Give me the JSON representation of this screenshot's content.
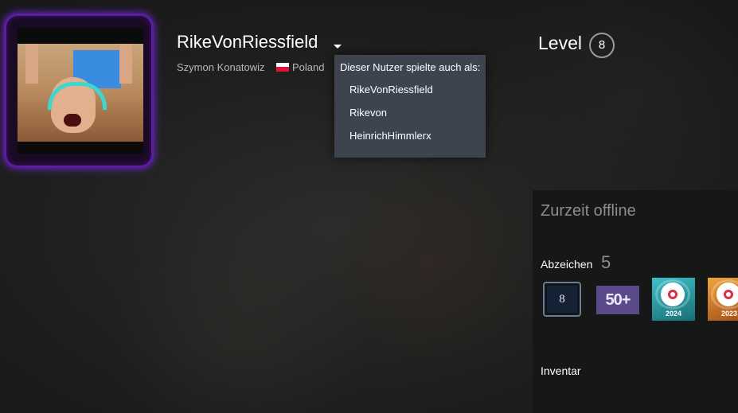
{
  "profile": {
    "persona_name": "RikeVonRiessfield",
    "real_name": "Szymon Konatowiz",
    "country": "Poland",
    "level_label": "Level",
    "level": "8"
  },
  "aliases": {
    "header": "Dieser Nutzer spielte auch als:",
    "items": [
      "RikeVonRiessfield",
      "Rikevon",
      "HeinrichHimmlerx"
    ]
  },
  "sidebar": {
    "status": "Zurzeit offline",
    "badges_label": "Abzeichen",
    "badges_count": "5",
    "badges": [
      {
        "icon": "level-8-badge-icon",
        "text": "8"
      },
      {
        "icon": "games-50-badge-icon",
        "text": "50+"
      },
      {
        "icon": "steam-replay-2024-badge-icon",
        "text": "2024"
      },
      {
        "icon": "steam-replay-2023-badge-icon",
        "text": "2023"
      }
    ],
    "inventory_label": "Inventar"
  },
  "colors": {
    "accent_frame": "#6d22c9",
    "dropdown_bg": "#3d4450",
    "panel_bg": "#161717"
  }
}
